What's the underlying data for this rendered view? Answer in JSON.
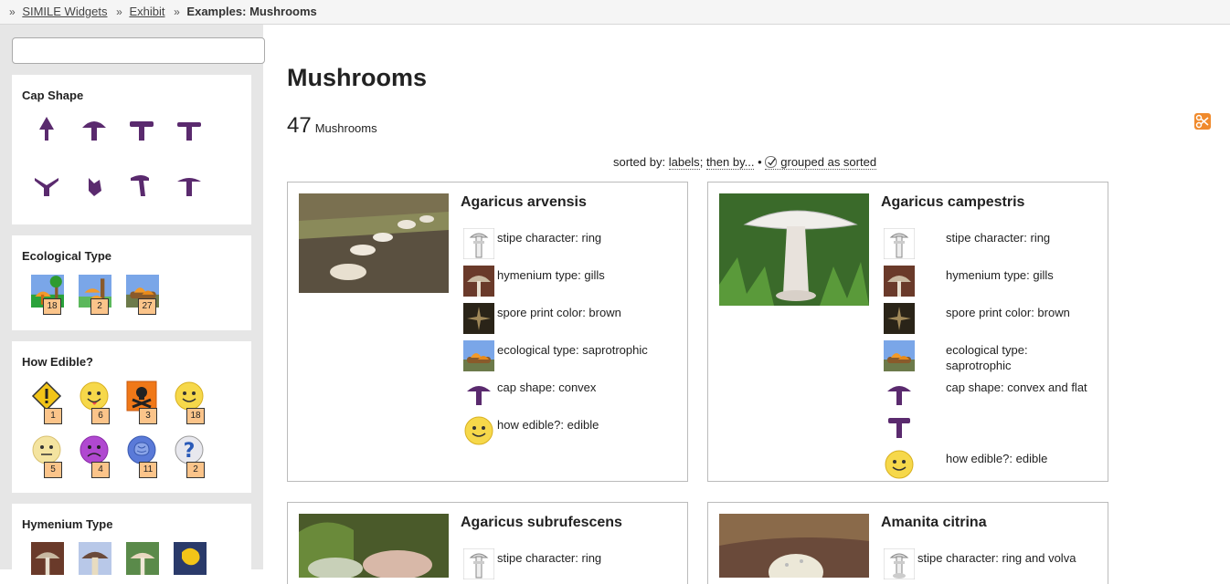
{
  "breadcrumb": {
    "items": [
      "SIMILE Widgets",
      "Exhibit"
    ],
    "current": "Examples: Mushrooms",
    "sep": "»"
  },
  "search": {
    "value": "",
    "placeholder": ""
  },
  "facets": {
    "cap_shape": {
      "title": "Cap Shape"
    },
    "ecological": {
      "title": "Ecological Type",
      "counts": [
        "18",
        "2",
        "27"
      ]
    },
    "edible": {
      "title": "How Edible?",
      "counts": [
        "1",
        "6",
        "3",
        "18",
        "5",
        "4",
        "11",
        "2"
      ]
    },
    "hymenium": {
      "title": "Hymenium Type"
    }
  },
  "main": {
    "title": "Mushrooms",
    "count": "47",
    "count_label": "Mushrooms",
    "sort_prefix": "sorted by:",
    "sort_labels": "labels",
    "sort_sep": ";",
    "sort_then": "then by...",
    "sort_dot": "•",
    "grouped": "grouped as sorted"
  },
  "cards": [
    {
      "name": "Agaricus arvensis",
      "props": [
        "stipe character: ring",
        "hymenium type: gills",
        "spore print color: brown",
        "ecological type: saprotrophic",
        "cap shape: convex",
        "how edible?: edible"
      ]
    },
    {
      "name": "Agaricus campestris",
      "props": [
        "stipe character: ring",
        "hymenium type: gills",
        "spore print color: brown",
        "ecological type:",
        "saprotrophic",
        "cap shape: convex and flat",
        "how edible?: edible"
      ]
    },
    {
      "name": "Agaricus subrufescens",
      "props": [
        "stipe character: ring"
      ]
    },
    {
      "name": "Amanita citrina",
      "props": [
        "stipe character: ring and volva"
      ]
    }
  ],
  "colors": {
    "accent_purple": "#5a2a6e",
    "badge": "#fbc48a",
    "sidebar_bg": "#e6e6e6"
  }
}
